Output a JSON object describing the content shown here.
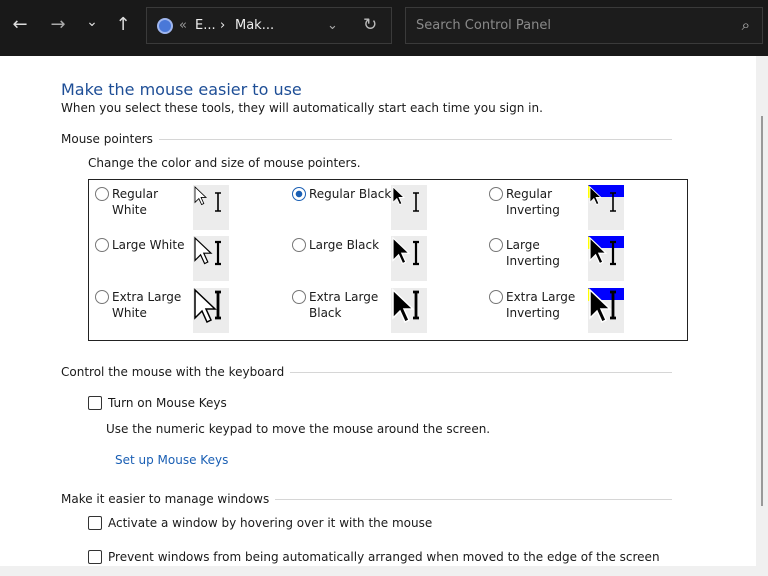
{
  "nav": {
    "back": "←",
    "forward": "→",
    "recent": "⌄",
    "up": "↑"
  },
  "address": {
    "prefix": "«",
    "crumb1": "E...",
    "sep": "›",
    "crumb2": "Mak...",
    "dropdown": "⌄",
    "refresh": "↻"
  },
  "search": {
    "placeholder": "Search Control Panel",
    "icon": "⌕"
  },
  "page": {
    "title": "Make the mouse easier to use",
    "subtitle": "When you select these tools, they will automatically start each time you sign in."
  },
  "pointers": {
    "heading": "Mouse pointers",
    "desc": "Change the color and size of mouse pointers.",
    "options": [
      {
        "label": "Regular White",
        "lines": [
          "Regular",
          "White"
        ],
        "style": "white",
        "size": 1,
        "selected": false
      },
      {
        "label": "Regular Black",
        "lines": [
          "Regular Black"
        ],
        "style": "black",
        "size": 1,
        "selected": true
      },
      {
        "label": "Regular Inverting",
        "lines": [
          "Regular",
          "Inverting"
        ],
        "style": "invert",
        "size": 1,
        "selected": false
      },
      {
        "label": "Large White",
        "lines": [
          "Large White"
        ],
        "style": "white",
        "size": 2,
        "selected": false
      },
      {
        "label": "Large Black",
        "lines": [
          "Large Black"
        ],
        "style": "black",
        "size": 2,
        "selected": false
      },
      {
        "label": "Large Inverting",
        "lines": [
          "Large",
          "Inverting"
        ],
        "style": "invert",
        "size": 2,
        "selected": false
      },
      {
        "label": "Extra Large White",
        "lines": [
          "Extra Large",
          "White"
        ],
        "style": "white",
        "size": 3,
        "selected": false
      },
      {
        "label": "Extra Large Black",
        "lines": [
          "Extra Large",
          "Black"
        ],
        "style": "black",
        "size": 3,
        "selected": false
      },
      {
        "label": "Extra Large Inverting",
        "lines": [
          "Extra Large",
          "Inverting"
        ],
        "style": "invert",
        "size": 3,
        "selected": false
      }
    ]
  },
  "keyboard": {
    "heading": "Control the mouse with the keyboard",
    "mouse_keys": "Turn on Mouse Keys",
    "desc": "Use the numeric keypad to move the mouse around the screen.",
    "link": "Set up Mouse Keys"
  },
  "windows": {
    "heading": "Make it easier to manage windows",
    "hover": "Activate a window by hovering over it with the mouse",
    "arrange": "Prevent windows from being automatically arranged when moved to the edge of the screen"
  }
}
